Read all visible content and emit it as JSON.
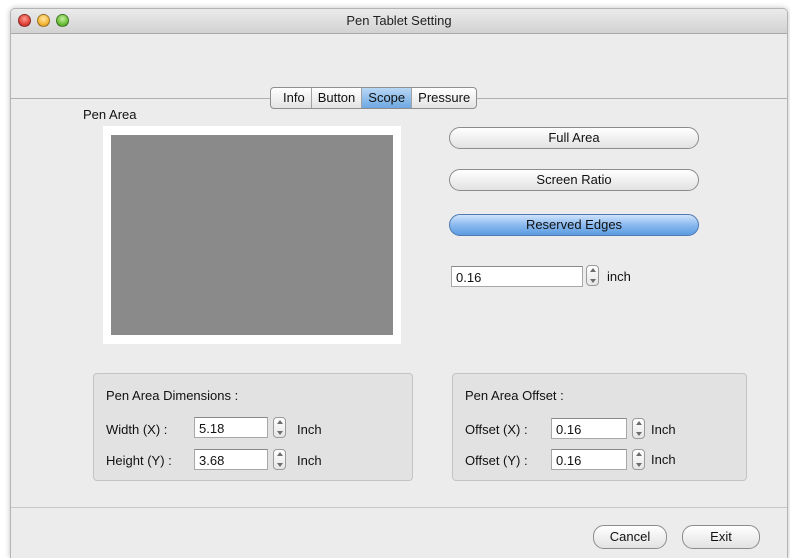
{
  "window": {
    "title": "Pen Tablet Setting"
  },
  "tabs": [
    {
      "label": "Info"
    },
    {
      "label": "Button"
    },
    {
      "label": "Scope",
      "active": true
    },
    {
      "label": "Pressure"
    }
  ],
  "pen_area": {
    "label": "Pen Area"
  },
  "area_buttons": {
    "full_area": "Full Area",
    "screen_ratio": "Screen Ratio",
    "reserved_edges": "Reserved Edges"
  },
  "edge": {
    "value": "0.16",
    "unit": "inch"
  },
  "dimensions": {
    "title": "Pen Area Dimensions :",
    "width_label": "Width  (X) :",
    "width_value": "5.18",
    "height_label": "Height (Y) :",
    "height_value": "3.68",
    "unit": "Inch"
  },
  "offset": {
    "title": "Pen Area Offset :",
    "x_label": "Offset (X) :",
    "x_value": "0.16",
    "y_label": "Offset (Y) :",
    "y_value": "0.16",
    "unit": "Inch"
  },
  "footer": {
    "cancel": "Cancel",
    "exit": "Exit"
  },
  "colors": {
    "accent": "#6ea8e2",
    "pen_area": "#8a8a8a"
  }
}
